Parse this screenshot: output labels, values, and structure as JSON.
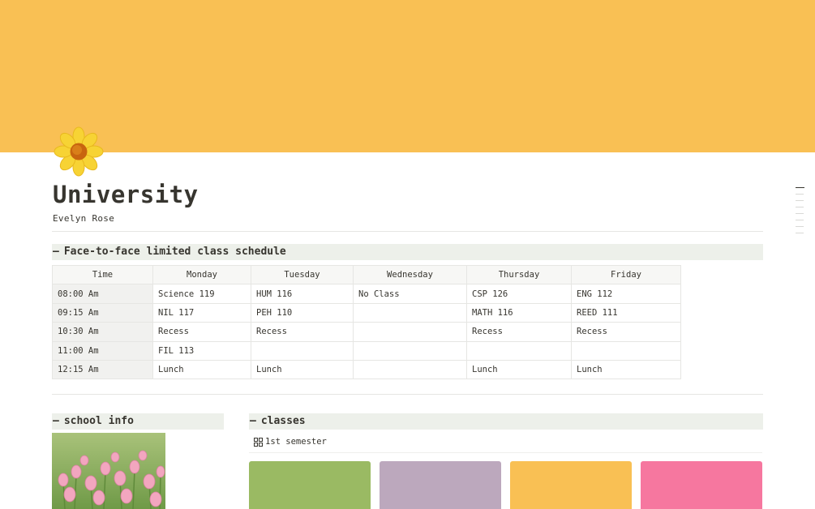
{
  "colors": {
    "cover": "#f9c054",
    "heading_bg": "#edf0ea",
    "card_green": "#9aba63",
    "card_purple": "#bca8bd",
    "card_yellow": "#f9c054",
    "card_pink": "#f6779f"
  },
  "page": {
    "icon": "sunflower-emoji-icon",
    "title": "University",
    "subtitle": "Evelyn Rose"
  },
  "schedule_section": {
    "toggle_icon": "dash-icon",
    "toggle_glyph": "—",
    "heading": "Face-to-face limited class schedule",
    "headers": [
      "Time",
      "Monday",
      "Tuesday",
      "Wednesday",
      "Thursday",
      "Friday"
    ],
    "rows": [
      [
        "08:00 Am",
        "Science 119",
        "HUM 116",
        "No Class",
        "CSP 126",
        "ENG 112"
      ],
      [
        "09:15 Am",
        "NIL 117",
        "PEH 110",
        "",
        "MATH 116",
        "REED 111"
      ],
      [
        "10:30 Am",
        "Recess",
        "Recess",
        "",
        "Recess",
        "Recess"
      ],
      [
        "11:00 Am",
        "FIL 113",
        "",
        "",
        "",
        ""
      ],
      [
        "12:15 Am",
        "Lunch",
        "Lunch",
        "",
        "Lunch",
        "Lunch"
      ]
    ]
  },
  "school_info": {
    "toggle_glyph": "—",
    "heading": "school info",
    "image": "pink-tulips-photo"
  },
  "classes": {
    "toggle_glyph": "—",
    "heading": "classes",
    "view_icon": "gallery-view-icon",
    "view_label": "1st semester",
    "cards": [
      "card_green",
      "card_purple",
      "card_yellow",
      "card_pink"
    ]
  }
}
